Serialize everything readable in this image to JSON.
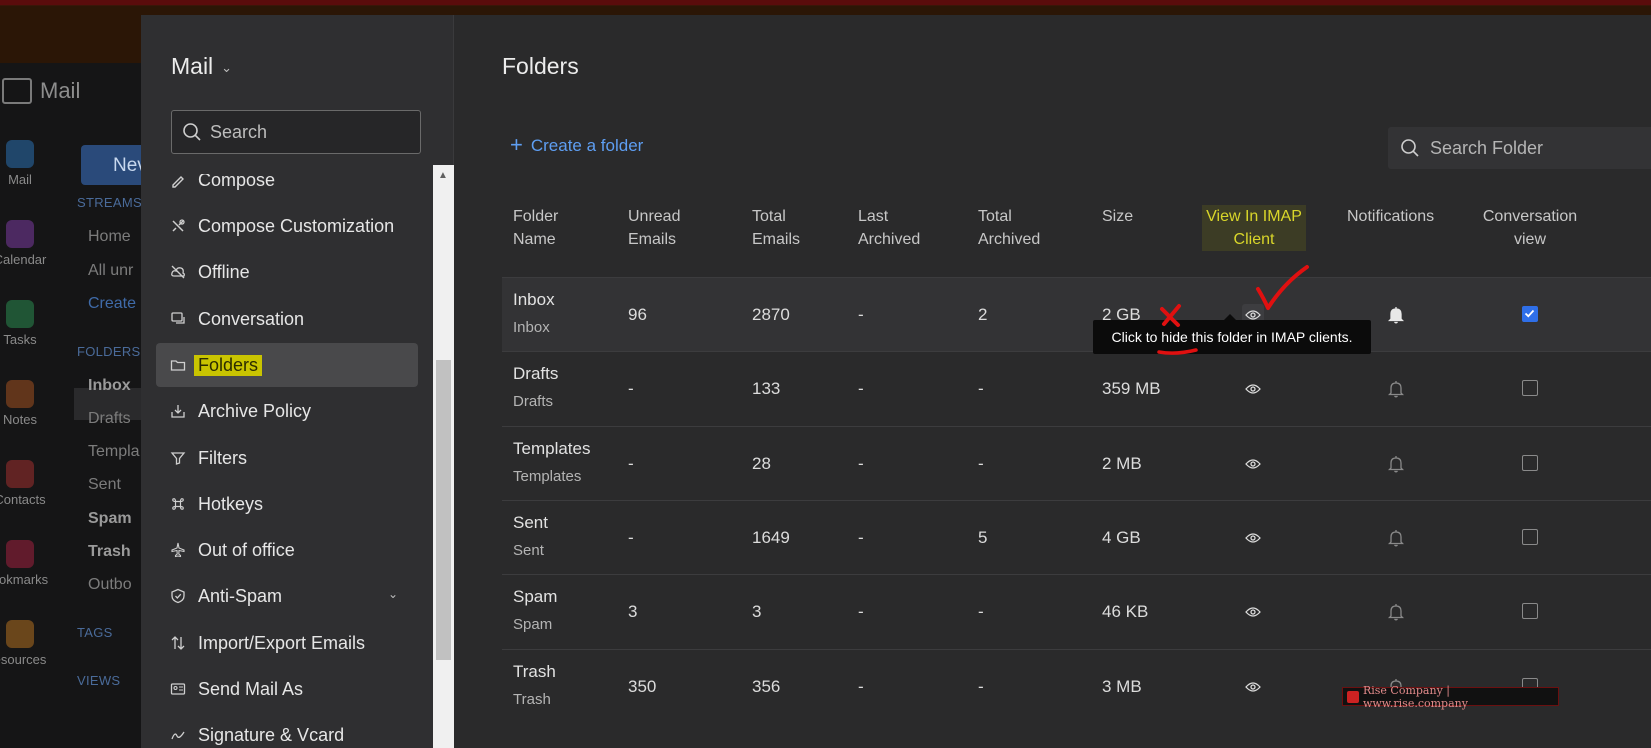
{
  "background_app": {
    "logo_text": "Mail",
    "new_button": "Nev",
    "rail": [
      {
        "label": "Mail",
        "color": "#2a6fb0"
      },
      {
        "label": "Calendar",
        "color": "#7a3aa0"
      },
      {
        "label": "Tasks",
        "color": "#2a8a50"
      },
      {
        "label": "Notes",
        "color": "#a05020"
      },
      {
        "label": "Contacts",
        "color": "#a03030"
      },
      {
        "label": "ookmarks",
        "color": "#a02040"
      },
      {
        "label": "esources",
        "color": "#b07020"
      }
    ],
    "nav": {
      "streams_head": "STREAMS",
      "home": "Home",
      "all_unread": "All unr",
      "create": "Create",
      "folders_head": "FOLDERS",
      "inbox": "Inbox",
      "drafts": "Drafts",
      "templates": "Templa",
      "sent": "Sent",
      "spam": "Spam",
      "trash": "Trash",
      "outbox": "Outbo",
      "tags_head": "TAGS",
      "views_head": "VIEWS"
    }
  },
  "sidebar": {
    "title": "Mail",
    "search_placeholder": "Search",
    "items": [
      {
        "label": "Compose",
        "icon": "pencil-icon"
      },
      {
        "label": "Compose Customization",
        "icon": "tools-icon"
      },
      {
        "label": "Offline",
        "icon": "cloud-off-icon"
      },
      {
        "label": "Conversation",
        "icon": "chat-icon"
      },
      {
        "label": "Folders",
        "icon": "folder-icon"
      },
      {
        "label": "Archive Policy",
        "icon": "archive-icon"
      },
      {
        "label": "Filters",
        "icon": "filter-icon"
      },
      {
        "label": "Hotkeys",
        "icon": "command-icon"
      },
      {
        "label": "Out of office",
        "icon": "plane-icon"
      },
      {
        "label": "Anti-Spam",
        "icon": "shield-icon"
      },
      {
        "label": "Import/Export Emails",
        "icon": "import-export-icon"
      },
      {
        "label": "Send Mail As",
        "icon": "id-card-icon"
      },
      {
        "label": "Signature & Vcard",
        "icon": "signature-icon"
      }
    ]
  },
  "main": {
    "title": "Folders",
    "create_folder": "Create a folder",
    "search_placeholder": "Search Folder",
    "columns": {
      "folder_name": [
        "Folder",
        "Name"
      ],
      "unread": [
        "Unread",
        "Emails"
      ],
      "total": [
        "Total",
        "Emails"
      ],
      "last_archived": [
        "Last",
        "Archived"
      ],
      "total_archived": [
        "Total",
        "Archived"
      ],
      "size": [
        "Size"
      ],
      "imap": [
        "View In IMAP",
        "Client"
      ],
      "notifications": [
        "Notifications"
      ],
      "conversation": [
        "Conversation",
        "view"
      ]
    },
    "rows": [
      {
        "name": "Inbox",
        "sub": "Inbox",
        "unread": "96",
        "total": "2870",
        "last_archived": "-",
        "total_archived": "2",
        "size": "2 GB",
        "notif": true,
        "conv": true
      },
      {
        "name": "Drafts",
        "sub": "Drafts",
        "unread": "-",
        "total": "133",
        "last_archived": "-",
        "total_archived": "-",
        "size": "359 MB",
        "notif": false,
        "conv": false
      },
      {
        "name": "Templates",
        "sub": "Templates",
        "unread": "-",
        "total": "28",
        "last_archived": "-",
        "total_archived": "-",
        "size": "2 MB",
        "notif": false,
        "conv": false
      },
      {
        "name": "Sent",
        "sub": "Sent",
        "unread": "-",
        "total": "1649",
        "last_archived": "-",
        "total_archived": "5",
        "size": "4 GB",
        "notif": false,
        "conv": false
      },
      {
        "name": "Spam",
        "sub": "Spam",
        "unread": "3",
        "total": "3",
        "last_archived": "-",
        "total_archived": "-",
        "size": "46 KB",
        "notif": false,
        "conv": false
      },
      {
        "name": "Trash",
        "sub": "Trash",
        "unread": "350",
        "total": "356",
        "last_archived": "-",
        "total_archived": "-",
        "size": "3 MB",
        "notif": false,
        "conv": false
      }
    ],
    "tooltip": "Click to hide this folder in IMAP clients."
  },
  "watermark": "Rise Company | www.rise.company",
  "colors": {
    "accent": "#5e9ef2",
    "highlight": "#c9c400",
    "annotation_red": "#e01010",
    "checkbox_on": "#2f6fe8"
  }
}
